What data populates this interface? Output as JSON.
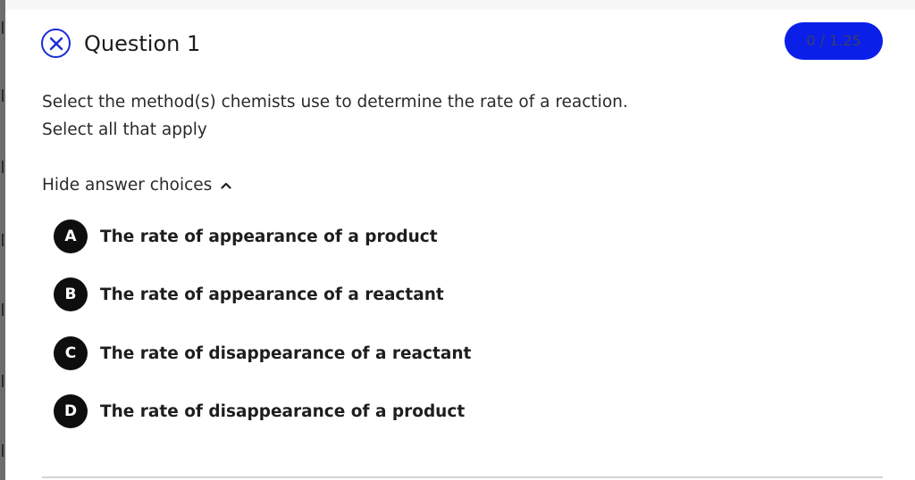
{
  "question": {
    "status_icon": "x-circle-icon",
    "title": "Question 1",
    "score": "0 / 1.25",
    "prompt": "Select the method(s) chemists use to determine the rate of a reaction.",
    "instruction": "Select all that apply"
  },
  "answer_toggle": {
    "label": "Hide answer choices",
    "icon": "chevron-up-icon"
  },
  "choices": [
    {
      "letter": "A",
      "text": "The rate of appearance of a product"
    },
    {
      "letter": "B",
      "text": "The rate of appearance of a reactant"
    },
    {
      "letter": "C",
      "text": "The rate of disappearance of a reactant"
    },
    {
      "letter": "D",
      "text": "The rate of disappearance of a product"
    }
  ],
  "colors": {
    "accent": "#0a1fe8",
    "status_icon": "#1a2bd8",
    "choice_badge": "#0e0e0e"
  }
}
